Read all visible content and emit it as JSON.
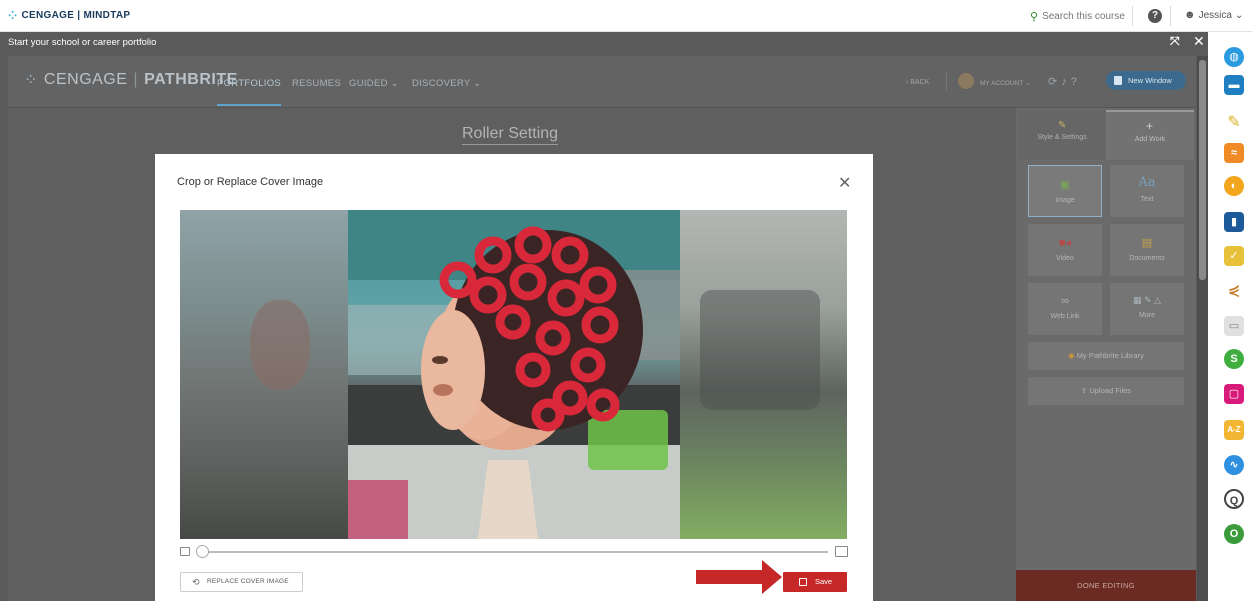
{
  "mindtap_bar": {
    "logo_text": "CENGAGE | MINDTAP",
    "search_label": "Search this course",
    "user_name": "Jessica"
  },
  "window": {
    "title": "Start your school or career portfolio"
  },
  "pathbrite": {
    "logo_prefix": "CENGAGE",
    "logo_product": "PATHBRITE",
    "nav": {
      "portfolios": "PORTFOLIOS",
      "resumes": "RESUMES",
      "guided": "GUIDED ⌄",
      "discovery": "DISCOVERY ⌄"
    },
    "back_label": "‹ BACK",
    "account_label": "MY ACCOUNT ⌄",
    "new_window_label": "New Window",
    "page_heading": "Roller Setting"
  },
  "edit_panel": {
    "tab_style": "Style & Settings",
    "tab_add": "Add Work",
    "tiles": {
      "image": "Image",
      "text": "Text",
      "video": "Video",
      "documents": "Documents",
      "web_link": "Web Link",
      "more": "More"
    },
    "library_label": "My Pathbrite Library",
    "upload_label": "Upload Files",
    "done_label": "DONE EDITING"
  },
  "modal": {
    "title": "Crop or Replace Cover Image",
    "close_symbol": "✕",
    "replace_label": "REPLACE COVER IMAGE",
    "save_label": "Save"
  },
  "colors": {
    "save_red": "#c62828",
    "arrow_red": "#c62828",
    "done_bar": "#6b2a22",
    "new_window_blue": "#3b6a8e"
  },
  "dock_icons": [
    "globe-icon",
    "briefcase-icon",
    "pencil-icon",
    "rss-icon",
    "circle-app-icon",
    "book-icon",
    "notes-icon",
    "share-icon",
    "chat-icon",
    "s-app-icon",
    "screen-icon",
    "az-icon",
    "wave-icon",
    "search-app-icon",
    "ring-icon"
  ]
}
